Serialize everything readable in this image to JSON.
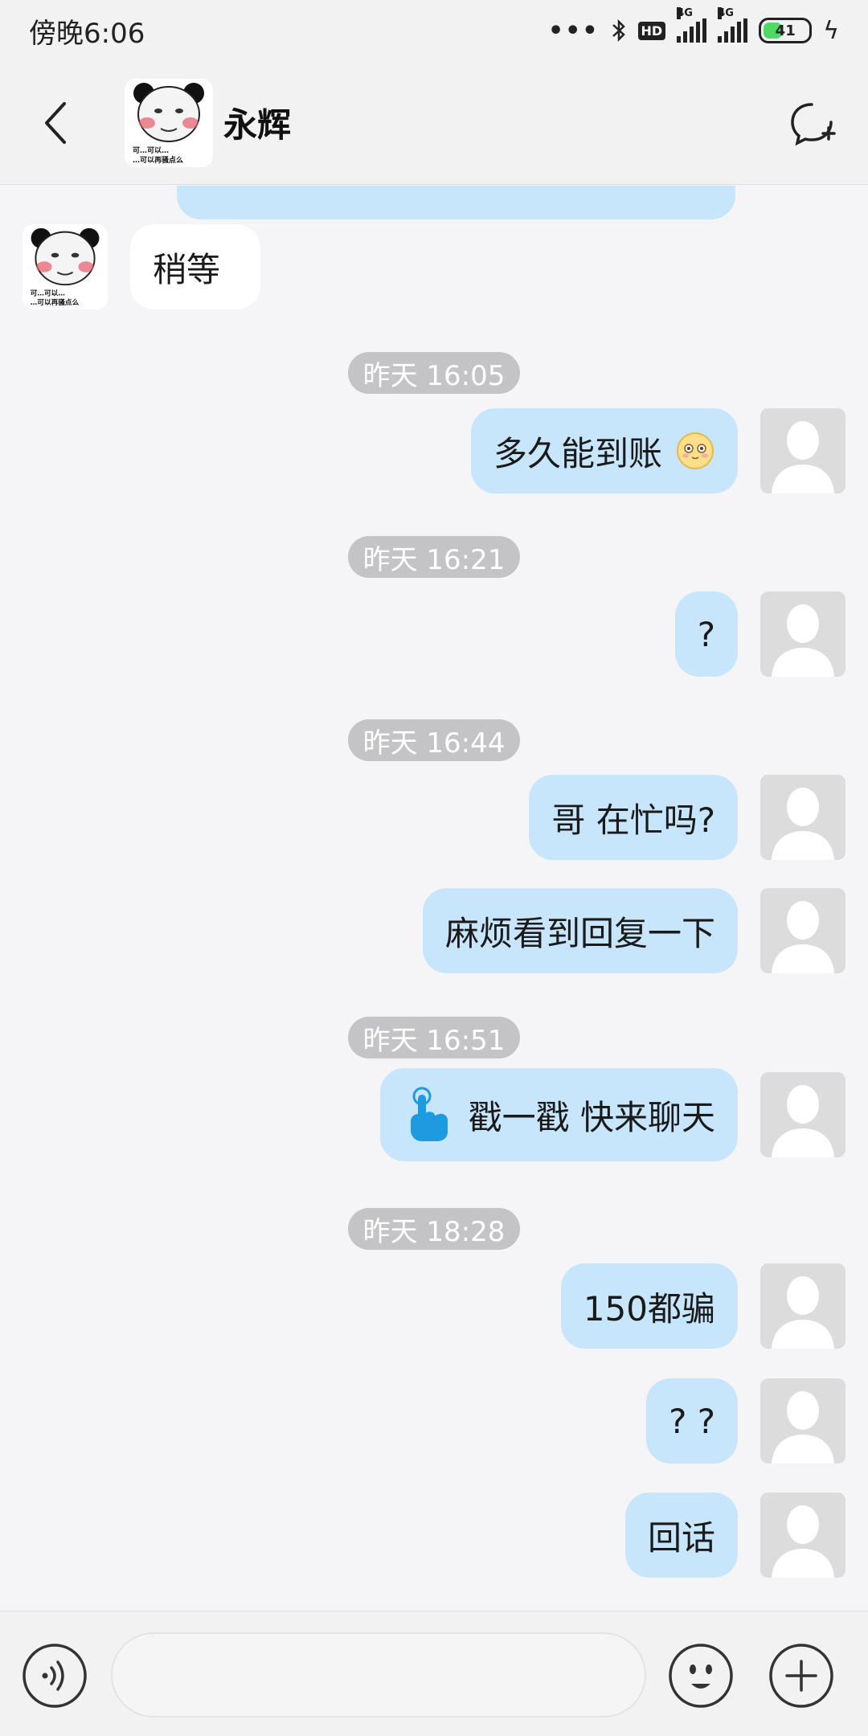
{
  "status_bar": {
    "time": "傍晚6:06",
    "dots": "•••",
    "hd": "HD",
    "net1": "4G",
    "net2": "4G",
    "battery": "41",
    "battery_fraction": 0.41
  },
  "header": {
    "contact_name": "永辉",
    "avatar_caption_1": "可…可以…",
    "avatar_caption_2": "…可以再骚点么"
  },
  "messages": [
    {
      "type": "in",
      "text": "稍等"
    },
    {
      "type": "time",
      "text": "昨天 16:05"
    },
    {
      "type": "out",
      "text": "多久能到账",
      "emoji": "smiling-face-icon"
    },
    {
      "type": "time",
      "text": "昨天 16:21"
    },
    {
      "type": "out",
      "text": "?"
    },
    {
      "type": "time",
      "text": "昨天 16:44"
    },
    {
      "type": "out",
      "text": "哥 在忙吗?"
    },
    {
      "type": "out",
      "text": "麻烦看到回复一下"
    },
    {
      "type": "time",
      "text": "昨天 16:51"
    },
    {
      "type": "out",
      "text": "戳一戳 快来聊天",
      "icon": "poke-finger-icon"
    },
    {
      "type": "time",
      "text": "昨天 18:28"
    },
    {
      "type": "out",
      "text": "150都骗"
    },
    {
      "type": "out",
      "text": "? ?"
    },
    {
      "type": "out",
      "text": "回话"
    }
  ],
  "input_bar": {
    "placeholder": ""
  },
  "colors": {
    "out_bubble": "#c7e6fb",
    "in_bubble": "#ffffff",
    "timestamp_bg": "#c4c4c6",
    "background": "#f5f5f7"
  }
}
